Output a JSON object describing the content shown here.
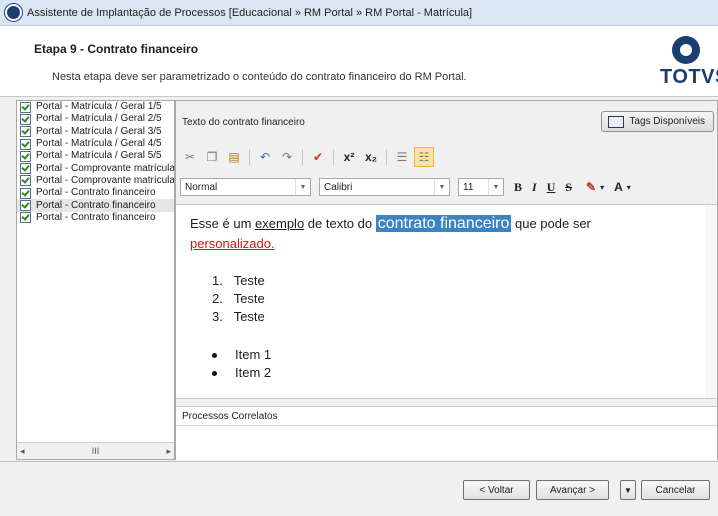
{
  "window": {
    "title": "Assistente de Implantação de Processos [Educacional » RM Portal » RM Portal - Matrícula]"
  },
  "header": {
    "step": "Etapa 9 - Contrato financeiro",
    "description": "Nesta etapa deve ser parametrizado o conteúdo do contrato financeiro do RM Portal.",
    "brand": "TOTVS"
  },
  "tree": {
    "items": [
      "Portal - Matrícula / Geral 1/5",
      "Portal - Matrícula / Geral 2/5",
      "Portal - Matrícula / Geral 3/5",
      "Portal - Matrícula / Geral 4/5",
      "Portal - Matrícula / Geral 5/5",
      "Portal - Comprovante matrícula",
      "Portal - Comprovante matrícula",
      "Portal - Contrato financeiro",
      "Portal - Contrato financeiro",
      "Portal - Contrato financeiro"
    ],
    "selected_index": 8,
    "scroll_thumb": "III"
  },
  "editor": {
    "label": "Texto do contrato financeiro",
    "tags_button": "Tags Disponíveis",
    "style": "Normal",
    "font": "Calibri",
    "size": "11",
    "bold": "B",
    "italic": "I",
    "underline": "U",
    "strike": "S",
    "font_color": "A",
    "text": {
      "p1": "Esse é um ",
      "link": "exemplo",
      "p2": " de texto do ",
      "highlight": "contrato financeiro",
      "p3": " que pode ser ",
      "red": "personalizado."
    },
    "ordered": [
      "Teste",
      "Teste",
      "Teste"
    ],
    "bullets": [
      "Item 1",
      "Item 2"
    ]
  },
  "related": {
    "label": "Processos Correlatos"
  },
  "buttons": {
    "back": "< Voltar",
    "next": "Avançar >",
    "menu": "▼",
    "cancel": "Cancelar"
  }
}
